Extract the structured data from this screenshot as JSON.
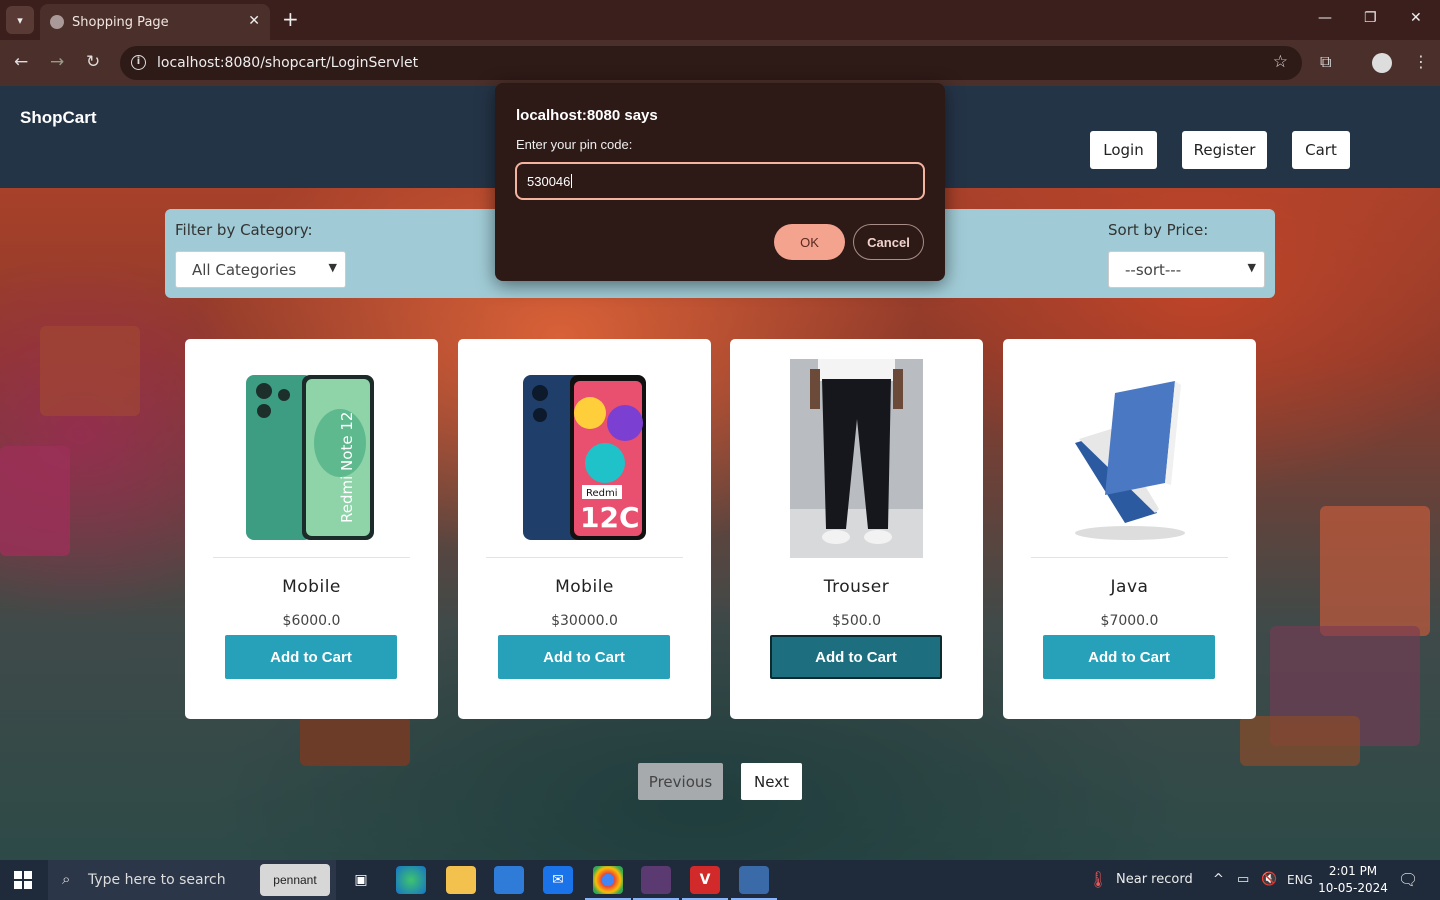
{
  "browser": {
    "tab_title": "Shopping Page",
    "url": "localhost:8080/shopcart/LoginServlet"
  },
  "site": {
    "brand": "ShopCart",
    "nav": {
      "login": "Login",
      "register": "Register",
      "cart": "Cart"
    }
  },
  "filters": {
    "category_label": "Filter by Category:",
    "category_value": "All Categories",
    "sort_label": "Sort by Price:",
    "sort_value": "--sort---"
  },
  "products": [
    {
      "name": "Mobile",
      "price": "$6000.0",
      "button": "Add to Cart",
      "image": "green-phone-image"
    },
    {
      "name": "Mobile",
      "price": "$30000.0",
      "button": "Add to Cart",
      "image": "blue-phone-image"
    },
    {
      "name": "Trouser",
      "price": "$500.0",
      "button": "Add to Cart",
      "image": "trouser-image"
    },
    {
      "name": "Java",
      "price": "$7000.0",
      "button": "Add to Cart",
      "image": "book-image"
    }
  ],
  "phone_texts": {
    "p1": "Redmi Note 12",
    "p2_brand": "Redmi",
    "p2_model": "12C"
  },
  "pagination": {
    "previous": "Previous",
    "next": "Next"
  },
  "dialog": {
    "title": "localhost:8080 says",
    "message": "Enter your pin code:",
    "input_value": "530046",
    "ok": "OK",
    "cancel": "Cancel"
  },
  "taskbar": {
    "search_placeholder": "Type here to search",
    "search_badge": "pennant",
    "weather": "Near record",
    "language": "ENG",
    "time": "2:01 PM",
    "date": "10-05-2024"
  },
  "colors": {
    "navbar": "#243447",
    "filterbar": "#a0cbd6",
    "add_button": "#27a0b9",
    "dialog_bg": "#2d1a17",
    "dialog_accent": "#f4a38f"
  }
}
